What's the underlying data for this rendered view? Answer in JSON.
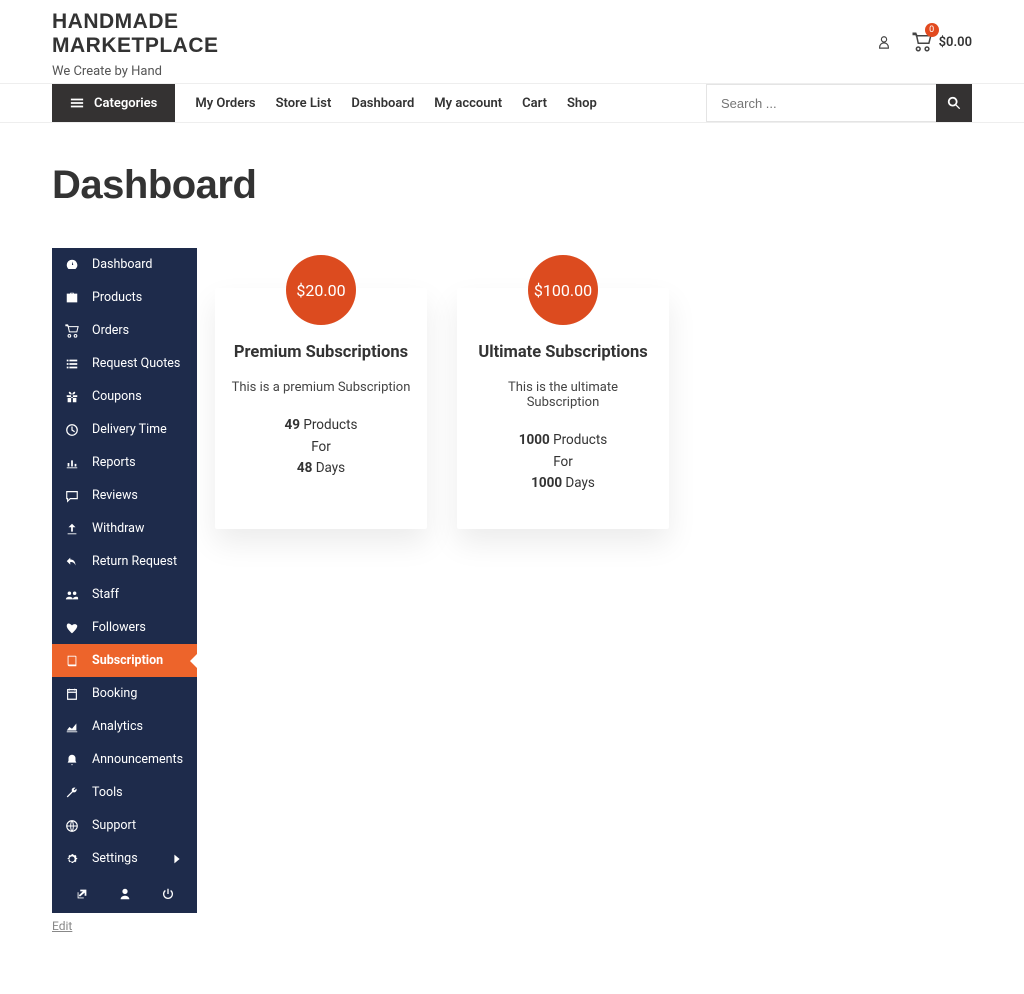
{
  "brand": {
    "title_line1": "HANDMADE",
    "title_line2": "MARKETPLACE",
    "sub": "We Create by Hand"
  },
  "header": {
    "cart_count": "0",
    "cart_price": "$0.00"
  },
  "nav": {
    "categories": "Categories",
    "links": [
      "My Orders",
      "Store List",
      "Dashboard",
      "My account",
      "Cart",
      "Shop"
    ],
    "search_placeholder": "Search ..."
  },
  "page": {
    "title": "Dashboard",
    "edit": "Edit"
  },
  "sidebar": {
    "items": [
      {
        "icon": "dashboard",
        "label": "Dashboard"
      },
      {
        "icon": "briefcase",
        "label": "Products"
      },
      {
        "icon": "cart",
        "label": "Orders"
      },
      {
        "icon": "list",
        "label": "Request Quotes"
      },
      {
        "icon": "gift",
        "label": "Coupons"
      },
      {
        "icon": "clock",
        "label": "Delivery Time"
      },
      {
        "icon": "chart",
        "label": "Reports"
      },
      {
        "icon": "comment",
        "label": "Reviews"
      },
      {
        "icon": "upload",
        "label": "Withdraw"
      },
      {
        "icon": "undo",
        "label": "Return Request"
      },
      {
        "icon": "users",
        "label": "Staff"
      },
      {
        "icon": "heart",
        "label": "Followers"
      },
      {
        "icon": "book",
        "label": "Subscription",
        "active": true
      },
      {
        "icon": "calendar",
        "label": "Booking"
      },
      {
        "icon": "analytics",
        "label": "Analytics"
      },
      {
        "icon": "bell",
        "label": "Announcements"
      },
      {
        "icon": "wrench",
        "label": "Tools"
      },
      {
        "icon": "globe",
        "label": "Support"
      },
      {
        "icon": "gear",
        "label": "Settings",
        "chevron": true
      }
    ]
  },
  "cards": [
    {
      "price": "$20.00",
      "title": "Premium Subscriptions",
      "desc": "This is a premium Subscription",
      "products": "49",
      "days": "48"
    },
    {
      "price": "$100.00",
      "title": "Ultimate Subscriptions",
      "desc": "This is the ultimate Subscription",
      "products": "1000",
      "days": "1000"
    }
  ],
  "labels": {
    "products": "Products",
    "for": "For",
    "days": "Days"
  }
}
